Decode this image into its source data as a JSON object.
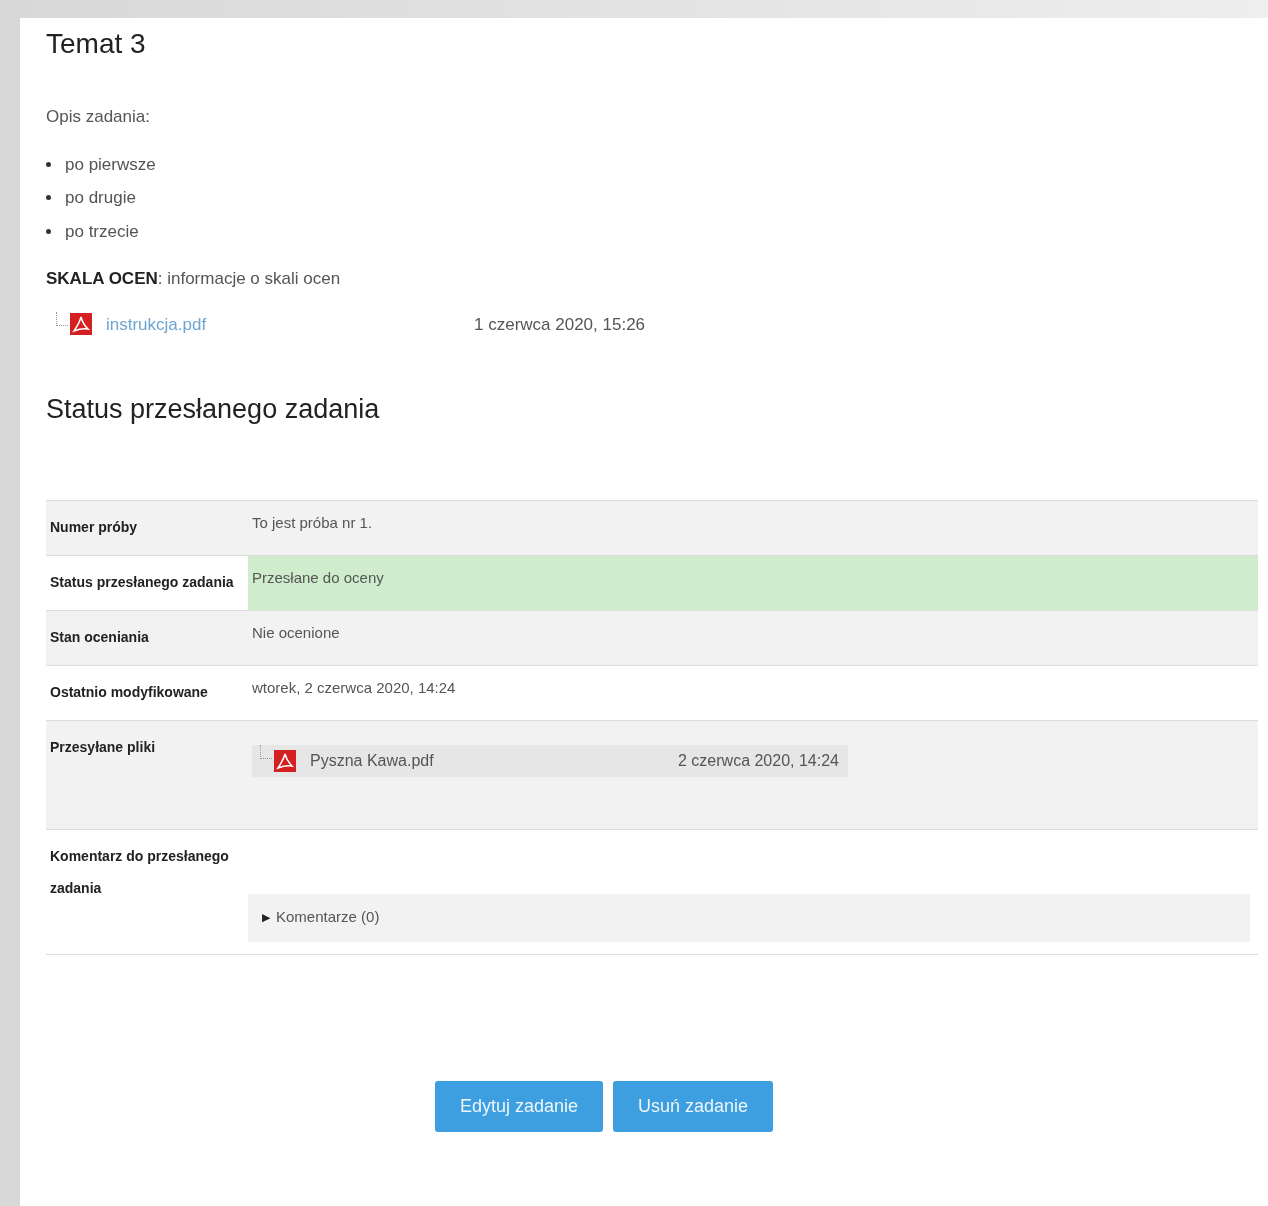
{
  "title": "Temat 3",
  "description": {
    "label": "Opis zadania:",
    "items": [
      "po pierwsze",
      "po drugie",
      "po trzecie"
    ],
    "scale": "**SKALA OCEN**: informacje o skali ocen"
  },
  "attachments": [
    {
      "name": "instrukcja.pdf",
      "date": "1 czerwca 2020, 15:26"
    }
  ],
  "status_heading": "Status przesłanego zadania",
  "rows": [
    {
      "kind": "text",
      "label": "Numer próby",
      "value": "To jest próba nr 1.",
      "highlight": false
    },
    {
      "kind": "text",
      "label": "Status przesłanego zadania",
      "value": "Przesłane do oceny",
      "highlight": true
    },
    {
      "kind": "text",
      "label": "Stan oceniania",
      "value": "Nie ocenione",
      "highlight": false
    },
    {
      "kind": "text",
      "label": "Ostatnio modyfikowane",
      "value": "wtorek, 2 czerwca 2020, 14:24",
      "highlight": false
    },
    {
      "kind": "files",
      "label": "Przesyłane pliki",
      "files": [
        {
          "name": "Pyszna Kawa.pdf",
          "date": "2 czerwca 2020, 14:24"
        }
      ]
    },
    {
      "kind": "comments",
      "label": "Komentarz do przesłanego zadania",
      "toggle": "▶",
      "link": "Komentarze (0)",
      "expanded": false
    }
  ],
  "buttons": [
    "Edytuj zadanie",
    "Usuń zadanie"
  ]
}
